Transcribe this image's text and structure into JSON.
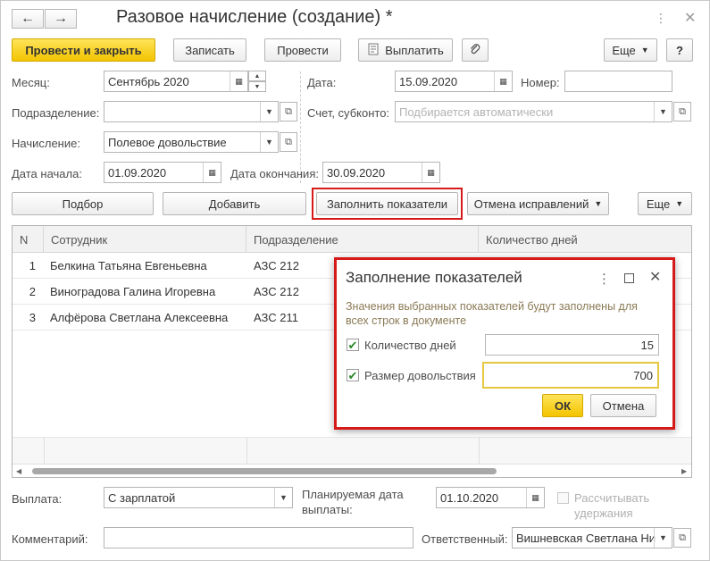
{
  "window": {
    "title": "Разовое начисление (создание) *",
    "nav_back": "←",
    "nav_forward": "→",
    "menu_icon": "⋮",
    "maximize_icon": "□",
    "close_icon": "✕"
  },
  "toolbar": {
    "post_close": "Провести и закрыть",
    "save": "Записать",
    "post": "Провести",
    "pay": "Выплатить",
    "more": "Еще",
    "help": "?"
  },
  "form": {
    "month_label": "Месяц:",
    "month_value": "Сентябрь 2020",
    "date_label": "Дата:",
    "date_value": "15.09.2020",
    "number_label": "Номер:",
    "number_value": "",
    "department_label": "Подразделение:",
    "department_value": "",
    "account_label": "Счет, субконто:",
    "account_placeholder": "Подбирается автоматически",
    "accrual_label": "Начисление:",
    "accrual_value": "Полевое довольствие",
    "start_label": "Дата начала:",
    "start_value": "01.09.2020",
    "end_label": "Дата окончания:",
    "end_value": "30.09.2020"
  },
  "table_toolbar": {
    "select": "Подбор",
    "add": "Добавить",
    "fill": "Заполнить показатели",
    "cancel_corrections": "Отмена исправлений",
    "more": "Еще"
  },
  "table": {
    "columns": [
      "N",
      "Сотрудник",
      "Подразделение",
      "Количество дней"
    ],
    "rows": [
      {
        "n": "1",
        "employee": "Белкина Татьяна Евгеньевна",
        "department": "АЗС 212"
      },
      {
        "n": "2",
        "employee": "Виноградова Галина Игоревна",
        "department": "АЗС 212"
      },
      {
        "n": "3",
        "employee": "Алфёрова Светлана Алексеевна",
        "department": "АЗС 211"
      }
    ]
  },
  "dialog": {
    "title": "Заполнение показателей",
    "info": "Значения выбранных показателей будут заполнены для всех строк в документе",
    "days_label": "Количество дней",
    "days_value": "15",
    "allowance_label": "Размер довольствия",
    "allowance_value": "700",
    "ok": "ОК",
    "cancel": "Отмена"
  },
  "footer": {
    "payment_label": "Выплата:",
    "payment_value": "С зарплатой",
    "planned_label_1": "Планируемая дата",
    "planned_label_2": "выплаты:",
    "planned_value": "01.10.2020",
    "calc_label_1": "Рассчитывать",
    "calc_label_2": "удержания",
    "comment_label": "Комментарий:",
    "comment_value": "",
    "responsible_label": "Ответственный:",
    "responsible_value": "Вишневская Светлана Ни"
  },
  "colors": {
    "accent_yellow": "#f3c400",
    "highlight_red": "#d61a1a",
    "check_green": "#2a8a2a"
  }
}
